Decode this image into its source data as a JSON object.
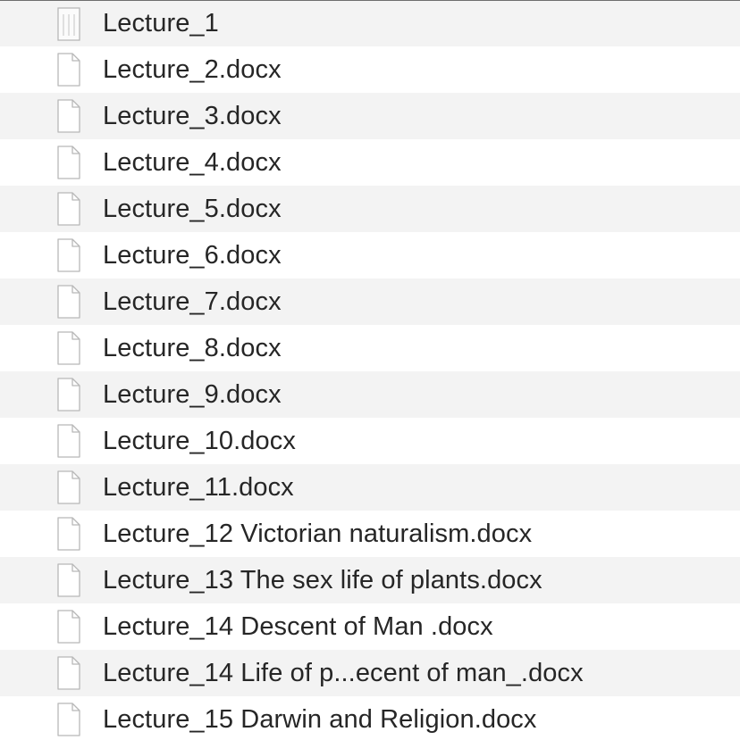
{
  "files": [
    {
      "name": "Lecture_1",
      "icon": "text-document-icon"
    },
    {
      "name": "Lecture_2.docx",
      "icon": "blank-document-icon"
    },
    {
      "name": "Lecture_3.docx",
      "icon": "blank-document-icon"
    },
    {
      "name": "Lecture_4.docx",
      "icon": "blank-document-icon"
    },
    {
      "name": "Lecture_5.docx",
      "icon": "blank-document-icon"
    },
    {
      "name": "Lecture_6.docx",
      "icon": "blank-document-icon"
    },
    {
      "name": "Lecture_7.docx",
      "icon": "blank-document-icon"
    },
    {
      "name": "Lecture_8.docx",
      "icon": "blank-document-icon"
    },
    {
      "name": "Lecture_9.docx",
      "icon": "blank-document-icon"
    },
    {
      "name": "Lecture_10.docx",
      "icon": "blank-document-icon"
    },
    {
      "name": "Lecture_11.docx",
      "icon": "blank-document-icon"
    },
    {
      "name": "Lecture_12 Victorian naturalism.docx",
      "icon": "blank-document-icon"
    },
    {
      "name": "Lecture_13 The sex life of plants.docx",
      "icon": "blank-document-icon"
    },
    {
      "name": "Lecture_14 Descent of Man .docx",
      "icon": "blank-document-icon"
    },
    {
      "name": "Lecture_14 Life of p...ecent of man_.docx",
      "icon": "blank-document-icon"
    },
    {
      "name": "Lecture_15 Darwin and Religion.docx",
      "icon": "blank-document-icon"
    }
  ],
  "colors": {
    "stripe": "#f3f3f3",
    "text": "#262626",
    "icon_stroke": "#b8b8b8"
  }
}
